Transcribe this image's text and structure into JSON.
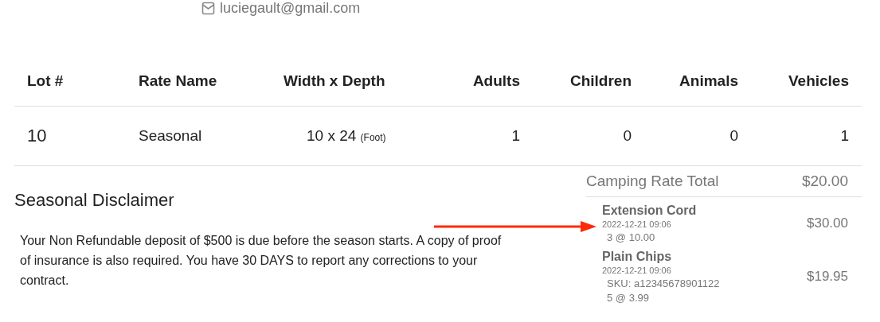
{
  "contact": {
    "email": "luciegault@gmail.com"
  },
  "table": {
    "columns": [
      "Lot #",
      "Rate Name",
      "Width x Depth",
      "Adults",
      "Children",
      "Animals",
      "Vehicles"
    ],
    "rows": [
      {
        "lot": "10",
        "rate_name": "Seasonal",
        "size": "10 x 24",
        "unit": "(Foot)",
        "adults": "1",
        "children": "0",
        "animals": "0",
        "vehicles": "1"
      }
    ]
  },
  "disclaimer": {
    "title": "Seasonal Disclaimer",
    "text": "Your Non Refundable deposit of $500 is due before the season starts. A copy of proof of insurance is also required. You have 30 DAYS to report any corrections to your contract."
  },
  "summary": {
    "label": "Camping Rate Total",
    "amount": "$20.00",
    "items": [
      {
        "name": "Extension Cord",
        "date": "2022-12-21 09:06",
        "details": [
          "3 @ 10.00"
        ],
        "amount": "$30.00"
      },
      {
        "name": "Plain Chips",
        "date": "2022-12-21 09:06",
        "details": [
          "SKU: a12345678901122",
          "5 @ 3.99"
        ],
        "amount": "$19.95"
      }
    ]
  }
}
